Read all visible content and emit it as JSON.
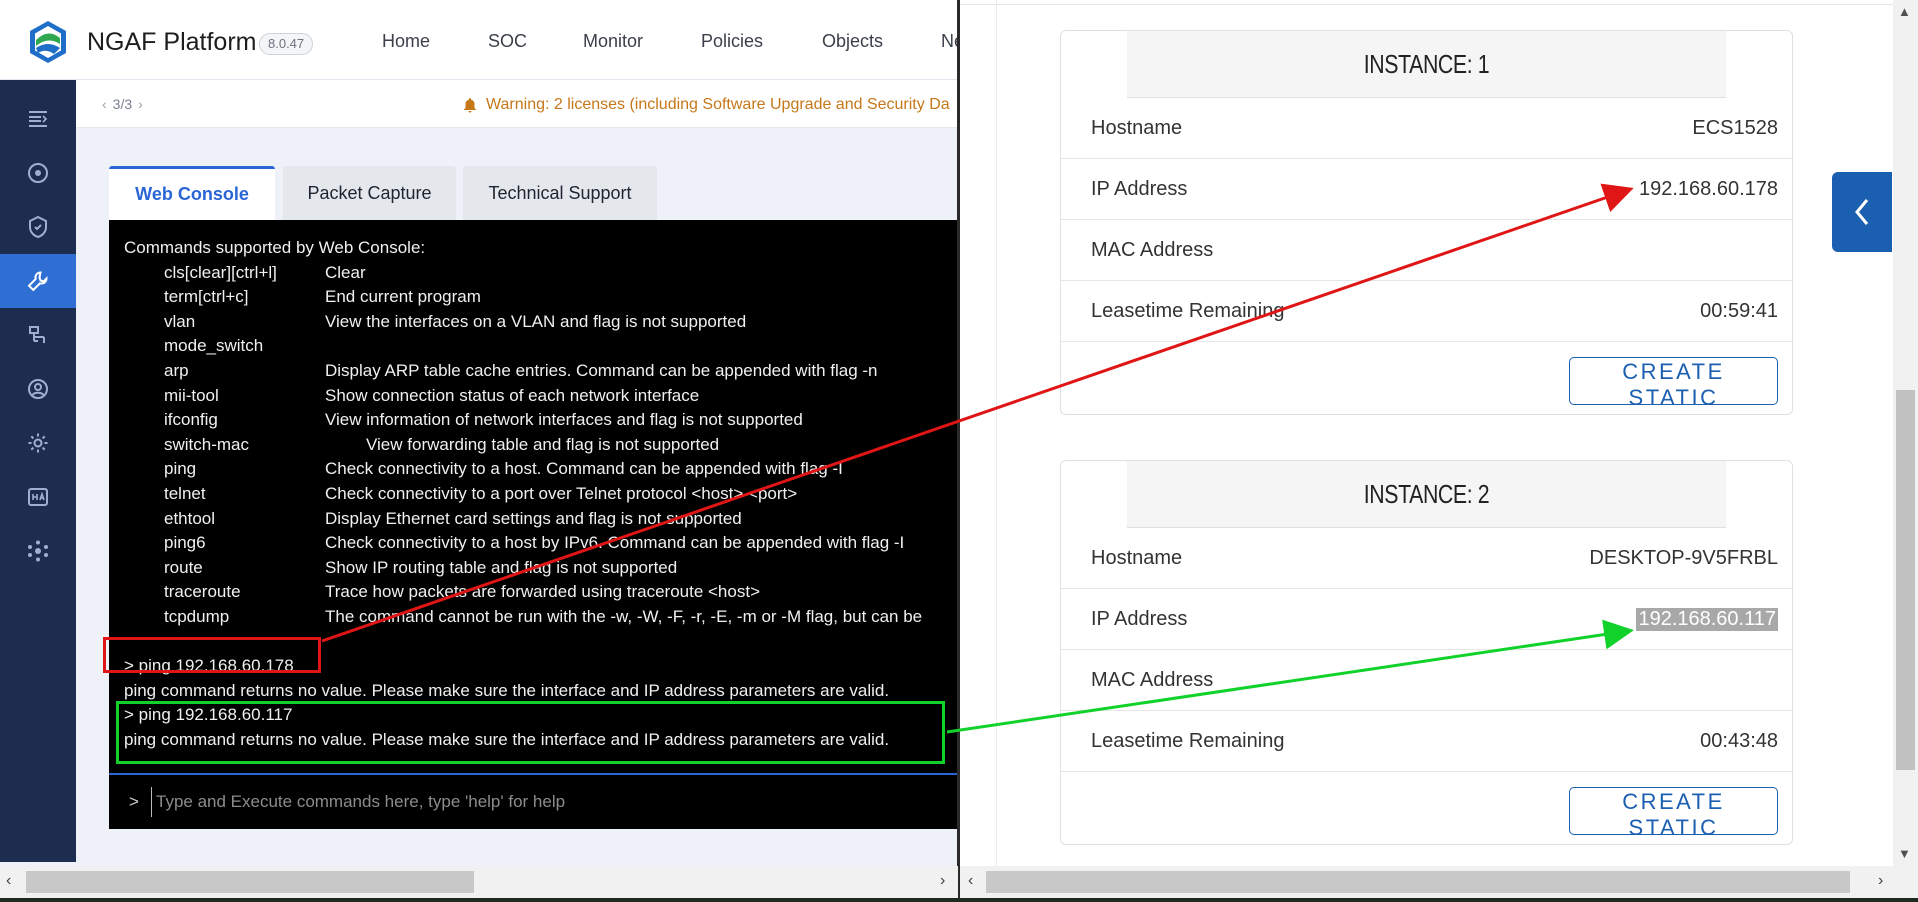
{
  "app": {
    "brand": "NGAF Platform",
    "version": "8.0.47",
    "nav": [
      "Home",
      "SOC",
      "Monitor",
      "Policies",
      "Objects",
      "Ne"
    ]
  },
  "warning": {
    "pager": "3/3",
    "text": "Warning: 2 licenses (including Software Upgrade and Security Da"
  },
  "tabs": [
    "Web Console",
    "Packet Capture",
    "Technical Support"
  ],
  "console": {
    "header": "Commands supported by Web Console:",
    "commands": [
      {
        "name": "cls[clear][ctrl+l]",
        "desc": "Clear"
      },
      {
        "name": "term[ctrl+c]",
        "desc": "End current program"
      },
      {
        "name": "vlan",
        "desc": "View the interfaces on a VLAN and flag is not supported"
      },
      {
        "name": "mode_switch",
        "desc": ""
      },
      {
        "name": "arp",
        "desc": "Display ARP table cache entries. Command can be appended with flag -n"
      },
      {
        "name": "mii-tool",
        "desc": "Show connection status of each network interface"
      },
      {
        "name": "ifconfig",
        "desc": "View information of network interfaces and flag is not supported"
      },
      {
        "name": "switch-mac",
        "desc": "View forwarding table and flag is not supported"
      },
      {
        "name": "ping",
        "desc": "Check connectivity to a host. Command can be appended with flag -I"
      },
      {
        "name": "telnet",
        "desc": "Check connectivity to a port over Telnet protocol <host> <port>"
      },
      {
        "name": "ethtool",
        "desc": "Display Ethernet card settings and flag is not supported"
      },
      {
        "name": "ping6",
        "desc": "Check connectivity to a host by IPv6. Command can be appended with flag -I"
      },
      {
        "name": "route",
        "desc": "Show IP routing table and flag is not supported"
      },
      {
        "name": "traceroute",
        "desc": "Trace how packets are forwarded using traceroute <host>"
      },
      {
        "name": "tcpdump",
        "desc": "The command cannot be run with the -w, -W, -F, -r, -E, -m or -M flag, but can be"
      }
    ],
    "session": [
      "> ping 192.168.60.178",
      "ping command returns no value. Please make sure the interface and IP address parameters are valid.",
      "> ping 192.168.60.117",
      "ping command returns no value. Please make sure the interface and IP address parameters are valid."
    ],
    "prompt": ">",
    "input_placeholder": "Type and Execute commands here, type 'help' for help",
    "input_value": ""
  },
  "instances": [
    {
      "title": "INSTANCE: 1",
      "rows": [
        {
          "key": "Hostname",
          "value": "ECS1528"
        },
        {
          "key": "IP Address",
          "value": "192.168.60.178"
        },
        {
          "key": "MAC Address",
          "value": ""
        },
        {
          "key": "Leasetime Remaining",
          "value": "00:59:41"
        }
      ],
      "button": "CREATE STATIC"
    },
    {
      "title": "INSTANCE: 2",
      "rows": [
        {
          "key": "Hostname",
          "value": "DESKTOP-9V5FRBL"
        },
        {
          "key": "IP Address",
          "value": "192.168.60.117"
        },
        {
          "key": "MAC Address",
          "value": ""
        },
        {
          "key": "Leasetime Remaining",
          "value": "00:43:48"
        }
      ],
      "button": "CREATE STATIC"
    }
  ],
  "colors": {
    "sidebar": "#1d2d4f",
    "accent": "#2a66d6",
    "warning": "#c6771a",
    "annotation_red": "#e01515",
    "annotation_green": "#10d22a",
    "button_blue": "#1b5fb0"
  },
  "icons": {
    "sidebar": [
      "menu-icon",
      "dashboard-icon",
      "shield-icon",
      "wrench-icon",
      "network-icon",
      "user-icon",
      "gear-icon",
      "ha-icon",
      "cluster-icon"
    ],
    "collapse": "chevron-left-icon",
    "warning": "bell-icon"
  }
}
